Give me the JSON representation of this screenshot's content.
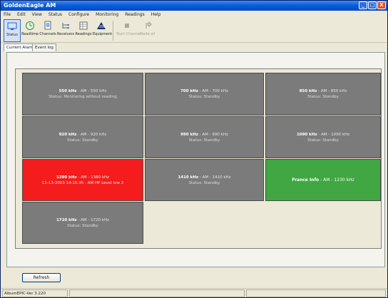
{
  "window": {
    "title": "GoldenEagle AM"
  },
  "title_buttons": [
    "_",
    "□",
    "X"
  ],
  "menu": [
    "File",
    "Edit",
    "View",
    "Status",
    "Configure",
    "Monitoring",
    "Readings",
    "Help"
  ],
  "toolbar": {
    "tools": [
      {
        "label": "Status",
        "icon": "status-monitor-icon",
        "pressed": true,
        "disabled": false
      },
      {
        "label": "Readtime",
        "icon": "clock-icon",
        "pressed": false,
        "disabled": false
      },
      {
        "label": "Channels",
        "icon": "channels-document-icon",
        "pressed": false,
        "disabled": false
      },
      {
        "label": "Receivers",
        "icon": "receivers-tree-icon",
        "pressed": false,
        "disabled": false
      },
      {
        "label": "Readings",
        "icon": "readings-table-icon",
        "pressed": false,
        "disabled": false
      },
      {
        "label": "Equipment",
        "icon": "equipment-logo-icon",
        "pressed": false,
        "disabled": false
      },
      {
        "label": "Start Channel",
        "icon": "stop-square-icon",
        "pressed": false,
        "disabled": true
      },
      {
        "label": "Redo all",
        "icon": "redo-arrow-icon",
        "pressed": false,
        "disabled": true
      }
    ]
  },
  "tabs": [
    {
      "label": "Current Alarms",
      "active": true
    },
    {
      "label": "Event log",
      "active": false
    }
  ],
  "tiles": [
    {
      "freq": "550 kHz",
      "line1_rest": " - AM - 550 kHz",
      "line2": "Status: Monitoring without reading",
      "color": "grey"
    },
    {
      "freq": "700 kHz",
      "line1_rest": " - AM - 700 kHz",
      "line2": "Status: Standby",
      "color": "grey"
    },
    {
      "freq": "850 kHz",
      "line1_rest": " - AM - 850 kHz",
      "line2": "Status: Standby",
      "color": "grey"
    },
    {
      "freq": "920 kHz",
      "line1_rest": " - AM - 920 kHz",
      "line2": "Status: Standby",
      "color": "grey"
    },
    {
      "freq": "990 kHz",
      "line1_rest": " - AM - 990 kHz",
      "line2": "Status: Standby",
      "color": "grey"
    },
    {
      "freq": "1090 kHz",
      "line1_rest": " - AM - 1090 kHz",
      "line2": "Status: Standby",
      "color": "grey"
    },
    {
      "freq": "1380 kHz",
      "line1_rest": " - AM - 1380 kHz",
      "line2": "11-13-2003 14:15:35 - AM HP Level low 2",
      "color": "red"
    },
    {
      "freq": "1410 kHz",
      "line1_rest": " - AM - 1410 kHz",
      "line2": "Status: Standby",
      "color": "grey"
    },
    {
      "freq": "France Info",
      "line1_rest": " - AM - 1230 kHz",
      "line2": "",
      "color": "green"
    },
    {
      "freq": "1720 kHz",
      "line1_rest": " - AM - 1720 kHz",
      "line2": "Status: Standby",
      "color": "grey"
    }
  ],
  "refresh_label": "Refresh",
  "status": {
    "left": "AlbumEPIC-Ver 3.220",
    "middle": "",
    "right": ""
  },
  "colors": {
    "red_alarm": "#f41c1c",
    "ok_green": "#40a742",
    "standby_grey": "#7b7b7b",
    "titlebar_blue": "#0a5fd8"
  }
}
